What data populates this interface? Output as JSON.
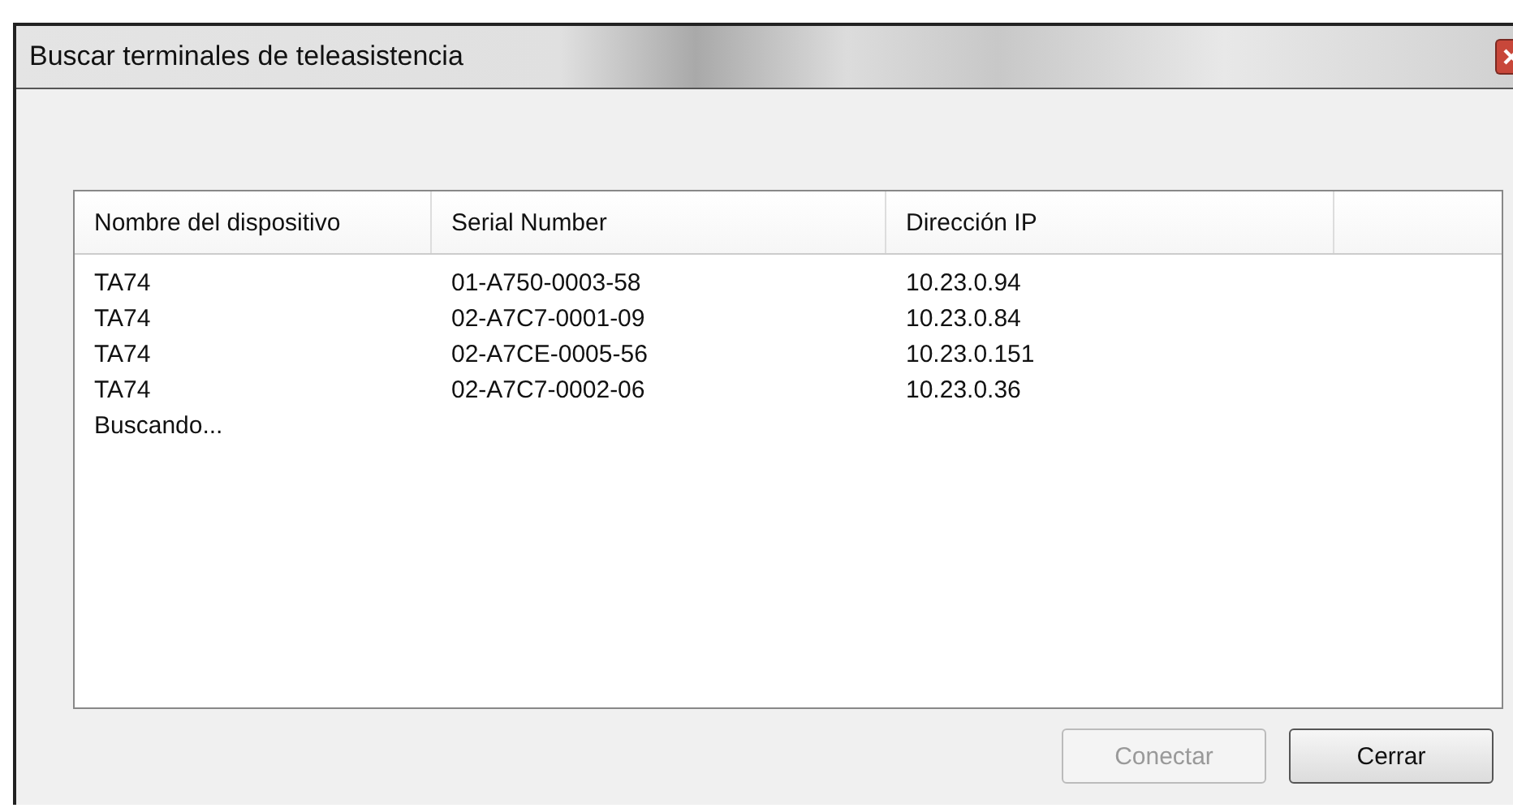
{
  "window": {
    "title": "Buscar terminales de teleasistencia"
  },
  "table": {
    "columns": [
      "Nombre del dispositivo",
      "Serial Number",
      "Dirección IP"
    ],
    "rows": [
      [
        "TA74",
        "01-A750-0003-58",
        "10.23.0.94"
      ],
      [
        "TA74",
        "02-A7C7-0001-09",
        "10.23.0.84"
      ],
      [
        "TA74",
        "02-A7CE-0005-56",
        "10.23.0.151"
      ],
      [
        "TA74",
        "02-A7C7-0002-06",
        "10.23.0.36"
      ]
    ],
    "status": "Buscando..."
  },
  "buttons": [
    {
      "label": "Conectar",
      "disabled": true
    },
    {
      "label": "Cerrar",
      "disabled": false
    }
  ]
}
